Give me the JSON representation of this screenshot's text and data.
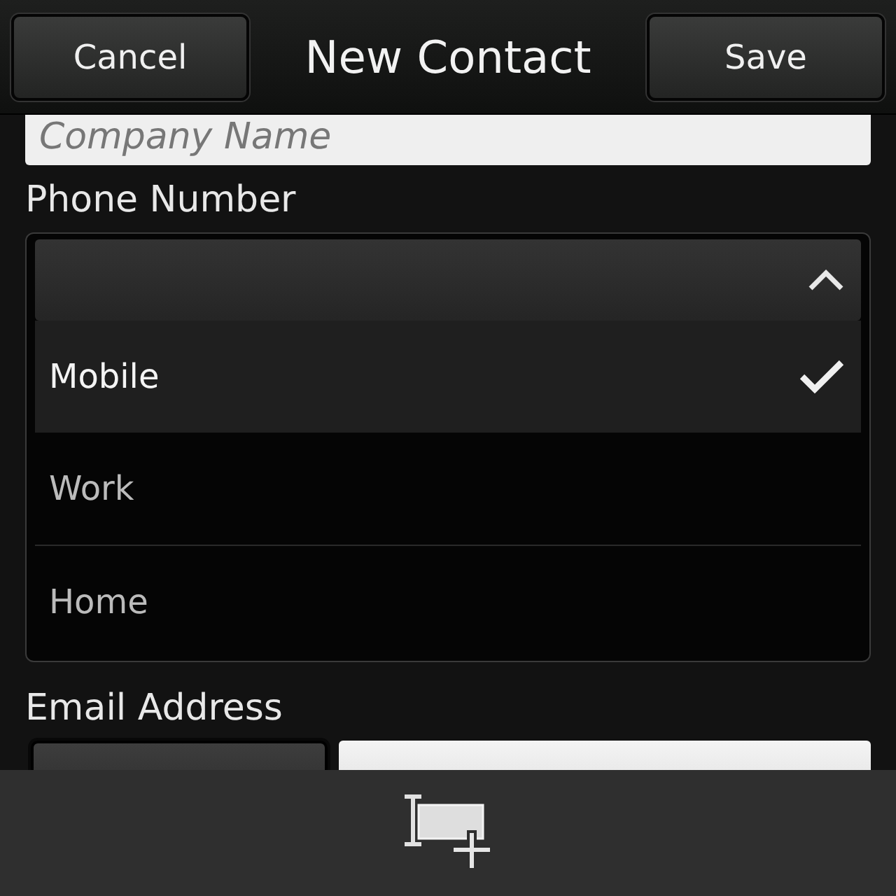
{
  "header": {
    "cancel": "Cancel",
    "title": "New Contact",
    "save": "Save"
  },
  "company_field": {
    "placeholder": "Company Name"
  },
  "phone": {
    "label": "Phone Number",
    "expanded": true,
    "options": [
      {
        "label": "Mobile",
        "selected": true
      },
      {
        "label": "Work",
        "selected": false
      },
      {
        "label": "Home",
        "selected": false
      }
    ]
  },
  "email": {
    "label": "Email Address"
  }
}
